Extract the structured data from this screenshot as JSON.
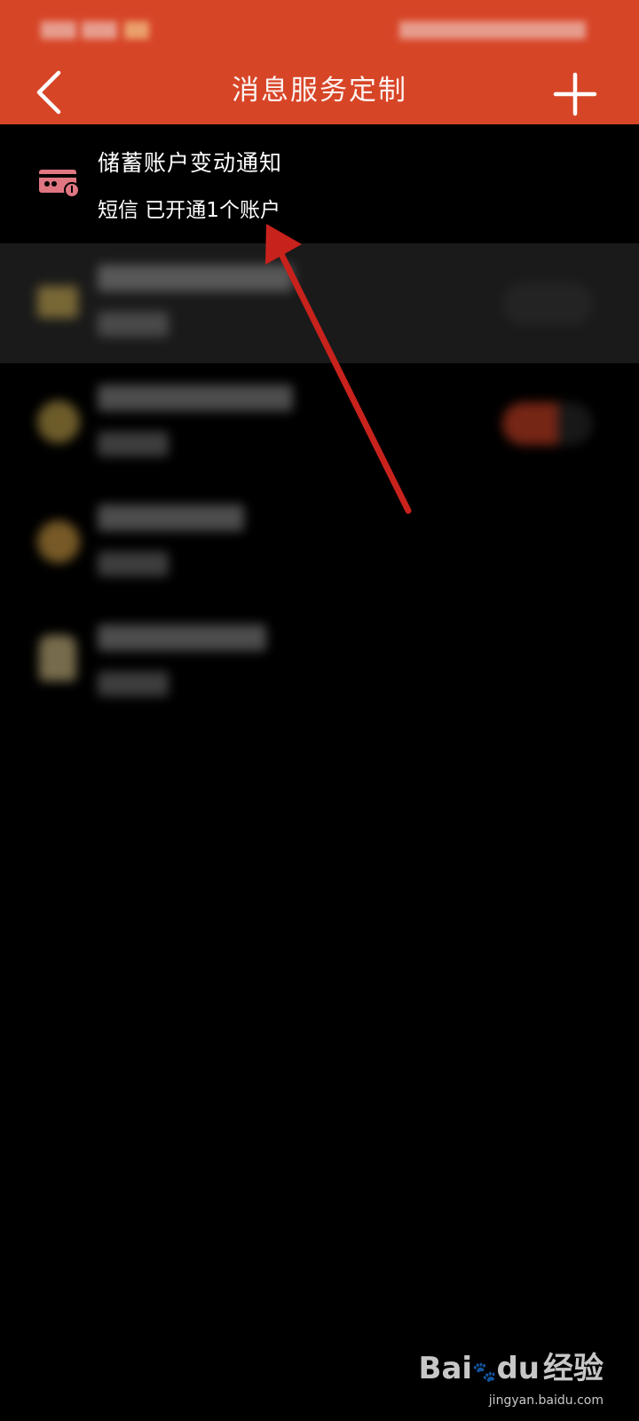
{
  "header": {
    "title": "消息服务定制",
    "back_icon": "back-chevron-icon",
    "add_icon": "plus-icon",
    "color": "#d74527"
  },
  "items": [
    {
      "title": "储蓄账户变动通知",
      "subtitle": "短信 已开通1个账户",
      "icon": "bank-card-icon",
      "icon_color": "#e07681"
    }
  ],
  "watermark": {
    "brand": "Bai",
    "brand_suffix": "du",
    "brand_tail": "经验",
    "url": "jingyan.baidu.com"
  }
}
